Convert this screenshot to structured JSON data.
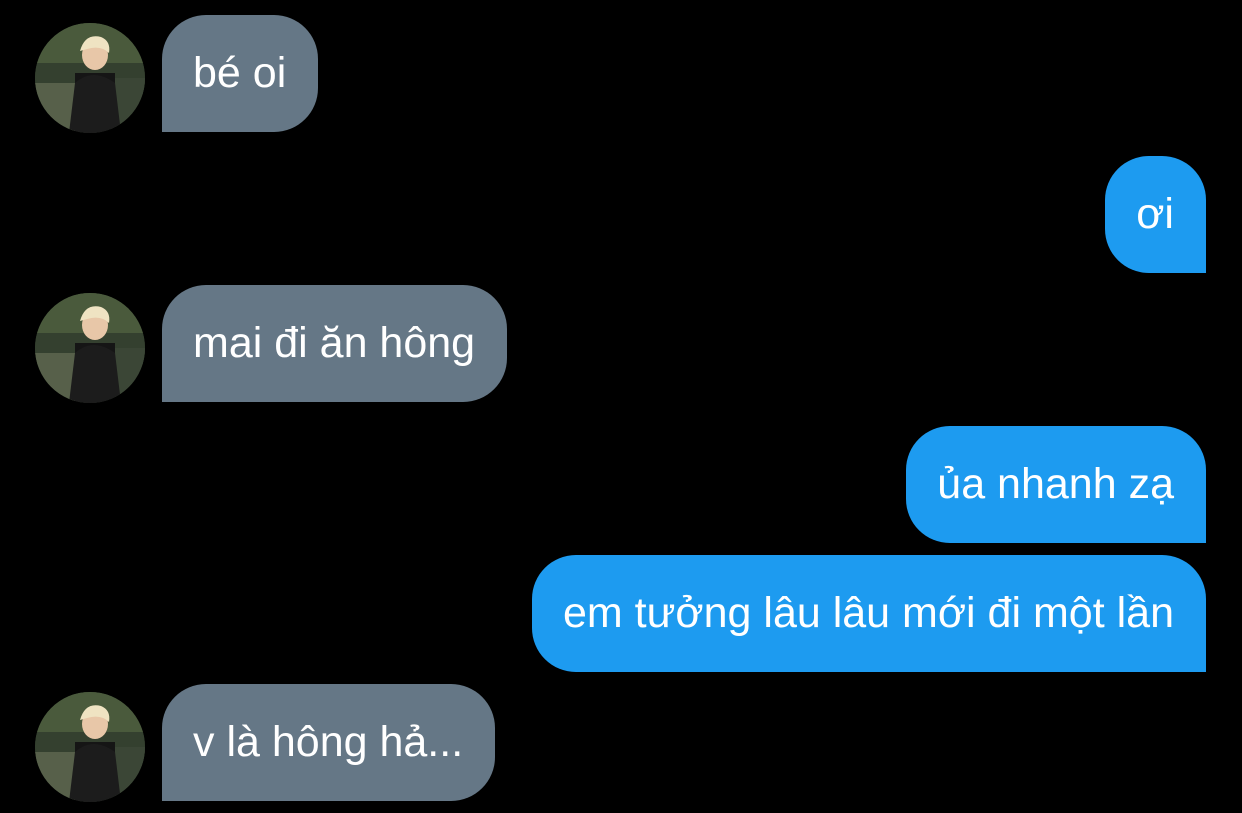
{
  "colors": {
    "background": "#000000",
    "incoming_bubble": "#657786",
    "outgoing_bubble": "#1d9bf0",
    "text": "#ffffff"
  },
  "messages": [
    {
      "direction": "incoming",
      "text": "bé oi"
    },
    {
      "direction": "outgoing",
      "text": "ơi"
    },
    {
      "direction": "incoming",
      "text": "mai đi ăn hông"
    },
    {
      "direction": "outgoing",
      "text": "ủa nhanh zạ"
    },
    {
      "direction": "outgoing",
      "text": "em tưởng lâu lâu mới đi một lần"
    },
    {
      "direction": "incoming",
      "text": "v là hông hả..."
    }
  ],
  "icons": {
    "avatar": "avatar-photo-icon"
  }
}
